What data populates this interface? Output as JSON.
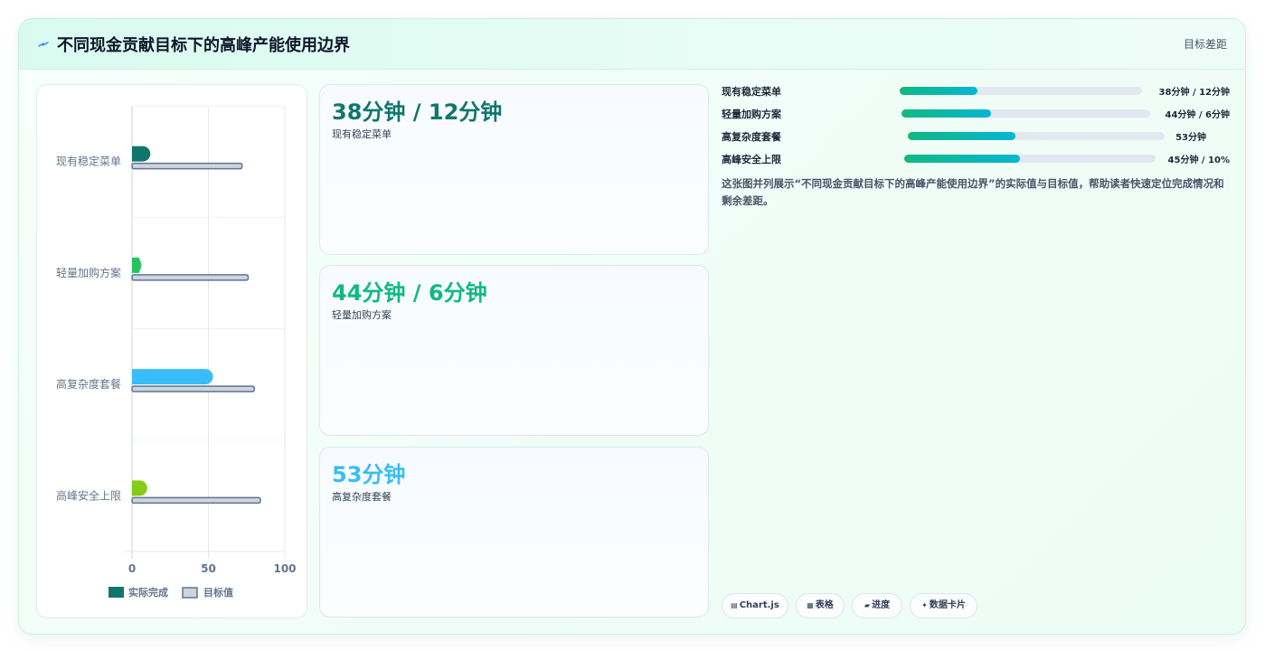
{
  "header": {
    "title": "不同现金贡献目标下的高峰产能使用边界",
    "tag": "目标差距"
  },
  "kpis": [
    {
      "value": "38分钟 / 12分钟",
      "label": "现有稳定菜单",
      "color": "#0f766e"
    },
    {
      "value": "44分钟 / 6分钟",
      "label": "轻量加购方案",
      "color": "#10b981"
    },
    {
      "value": "53分钟",
      "label": "高复杂度套餐",
      "color": "#38bdf8"
    }
  ],
  "progress": [
    {
      "label": "现有稳定菜单",
      "value": "38分钟 / 12分钟",
      "fraction": 0.32
    },
    {
      "label": "轻量加购方案",
      "value": "44分钟 / 6分钟",
      "fraction": 0.36
    },
    {
      "label": "高复杂度套餐",
      "value": "53分钟",
      "fraction": 0.42
    },
    {
      "label": "高峰安全上限",
      "value": "45分钟 / 10%",
      "fraction": 0.46
    }
  ],
  "description": "这张图并列展示“不同现金贡献目标下的高峰产能使用边界”的实际值与目标值，帮助读者快速定位完成情况和剩余差距。",
  "chips": [
    {
      "icon": "▤",
      "label": "Chart.js",
      "icon_name": "chart-icon"
    },
    {
      "icon": "▦",
      "label": "表格",
      "icon_name": "table-icon"
    },
    {
      "icon": "▰",
      "label": "进度",
      "icon_name": "progress-icon"
    },
    {
      "icon": "✦",
      "label": "数据卡片",
      "icon_name": "sparkle-icon"
    }
  ],
  "chart_data": {
    "type": "bar",
    "orientation": "horizontal",
    "categories": [
      "现有稳定菜单",
      "轻量加购方案",
      "高复杂度套餐",
      "高峰安全上限"
    ],
    "series": [
      {
        "name": "实际完成",
        "values": [
          12,
          6,
          53,
          10
        ],
        "colors": [
          "#0f766e",
          "#22c55e",
          "#38bdf8",
          "#84cc16"
        ]
      },
      {
        "name": "目标值",
        "values": [
          72,
          76,
          80,
          84
        ],
        "color": "#cbd5e1",
        "border": "#64748b"
      }
    ],
    "x_ticks": [
      "0",
      "50",
      "100"
    ],
    "xlim": [
      0,
      100
    ],
    "grid": true,
    "legend": "bottom"
  }
}
